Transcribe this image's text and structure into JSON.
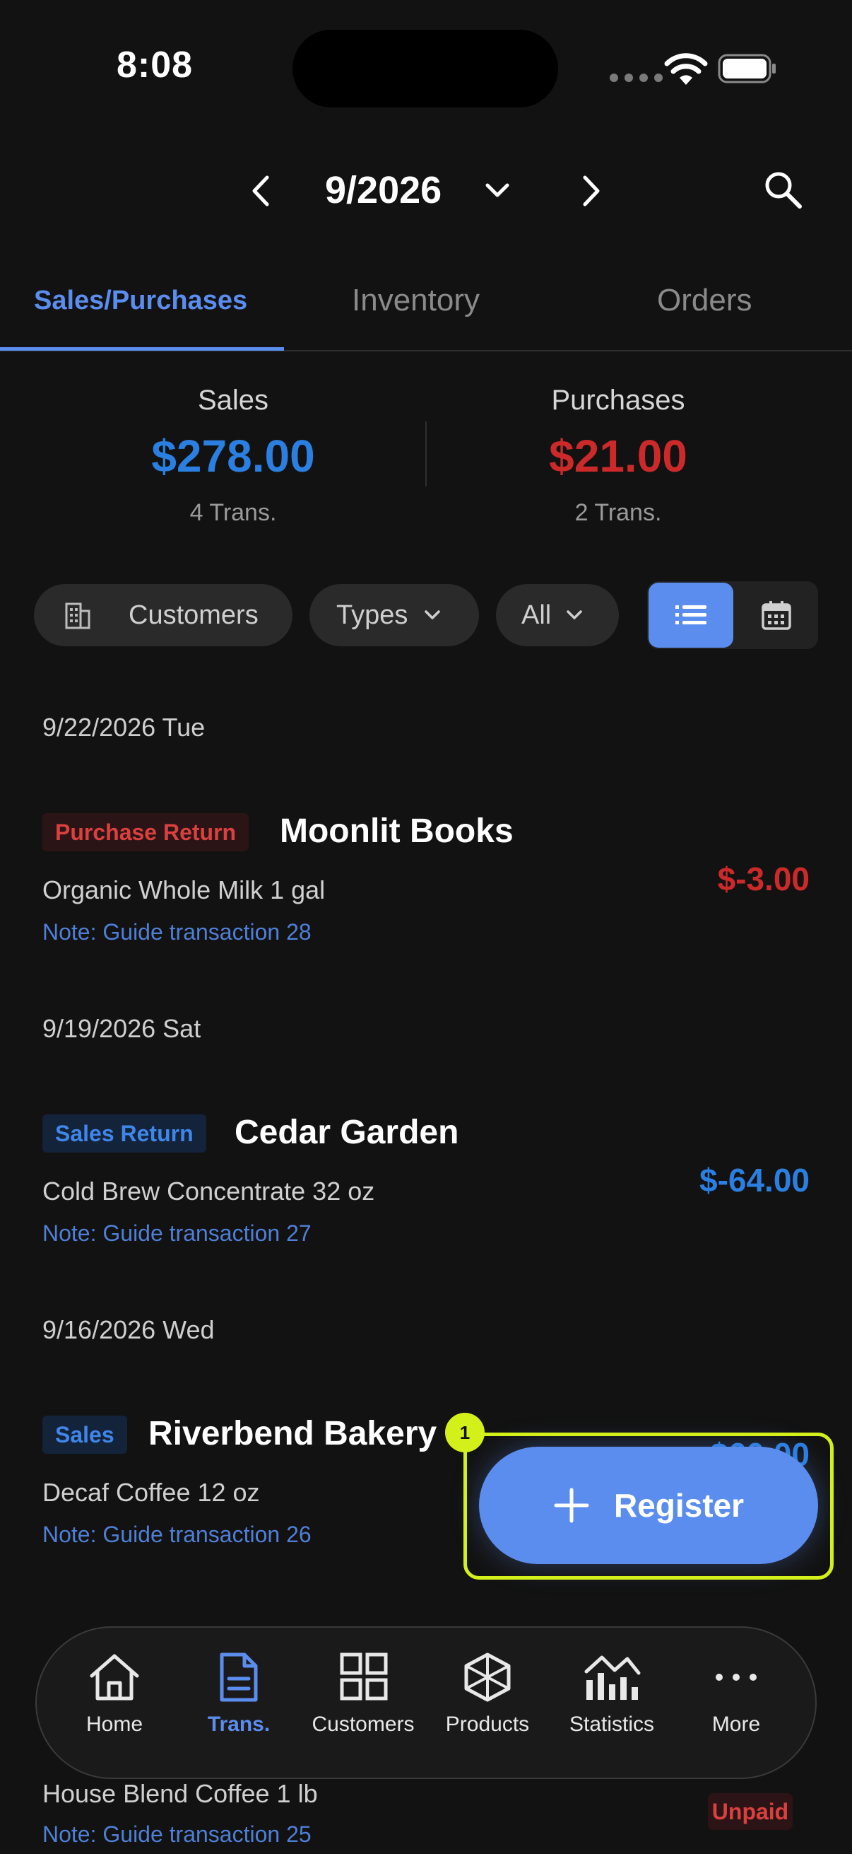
{
  "status_bar": {
    "time": "8:08"
  },
  "header": {
    "month": "9/2026"
  },
  "tabs": [
    {
      "label": "Sales/Purchases"
    },
    {
      "label": "Inventory"
    },
    {
      "label": "Orders"
    }
  ],
  "summary": {
    "sales_label": "Sales",
    "sales_value": "$278.00",
    "sales_count": "4 Trans.",
    "purchases_label": "Purchases",
    "purchases_value": "$21.00",
    "purchases_count": "2 Trans."
  },
  "filters": {
    "customers": "Customers",
    "types": "Types",
    "all": "All"
  },
  "transactions": [
    {
      "date": "9/22/2026 Tue",
      "badge": "Purchase Return",
      "name": "Moonlit Books",
      "item": "Organic Whole Milk 1 gal",
      "note": "Note: Guide transaction 28",
      "amount": "$-3.00"
    },
    {
      "date": "9/19/2026 Sat",
      "badge": "Sales Return",
      "name": "Cedar Garden",
      "item": "Cold Brew Concentrate 32 oz",
      "note": "Note: Guide transaction 27",
      "amount": "$-64.00"
    },
    {
      "date": "9/16/2026 Wed",
      "badge": "Sales",
      "name": "Riverbend Bakery",
      "item": "Decaf Coffee 12 oz",
      "note": "Note: Guide transaction 26",
      "amount": "$60.00"
    },
    {
      "item": "House Blend Coffee 1 lb",
      "note": "Note: Guide transaction 25",
      "status": "Unpaid"
    }
  ],
  "fab": {
    "label": "Register",
    "marker": "1"
  },
  "bottom_nav": [
    {
      "label": "Home",
      "icon": "home-icon"
    },
    {
      "label": "Trans.",
      "icon": "document-icon"
    },
    {
      "label": "Customers",
      "icon": "grid-icon"
    },
    {
      "label": "Products",
      "icon": "cube-icon"
    },
    {
      "label": "Statistics",
      "icon": "chart-icon"
    },
    {
      "label": "More",
      "icon": "more-icon"
    }
  ],
  "colors": {
    "accent": "#5b8def",
    "sales": "#2a7fe0",
    "purchases": "#cc2a2a",
    "highlight": "#d4f01a"
  }
}
